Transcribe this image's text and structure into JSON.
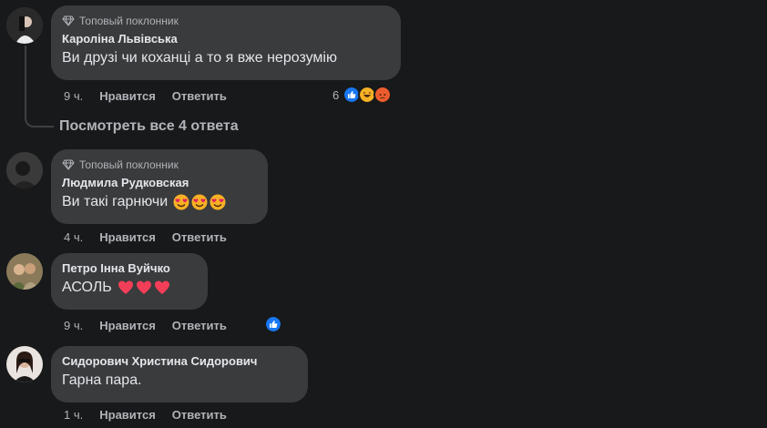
{
  "comments": [
    {
      "badge": "Топовый поклонник",
      "author": "Кароліна Львівська",
      "text": "Ви друзі чи коханці а то я вже нерозумію",
      "time": "9 ч.",
      "like": "Нравится",
      "reply": "Ответить",
      "reaction_count": "6"
    },
    {
      "badge": "Топовый поклонник",
      "author": "Людмила Рудковская",
      "text": "Ви такі гарнючи",
      "time": "4 ч.",
      "like": "Нравится",
      "reply": "Ответить"
    },
    {
      "author": "Петро Інна Вуйчко",
      "text": "АСОЛЬ",
      "time": "9 ч.",
      "like": "Нравится",
      "reply": "Ответить"
    },
    {
      "author": "Сидорович Христина Сидорович",
      "text": "Гарна пара.",
      "time": "1 ч.",
      "like": "Нравится",
      "reply": "Ответить"
    }
  ],
  "view_replies": "Посмотреть все 4 ответа",
  "colors": {
    "background": "#18191a",
    "bubble": "#3a3b3c",
    "like_blue": "#1877f2",
    "heart_red": "#f33e58"
  }
}
